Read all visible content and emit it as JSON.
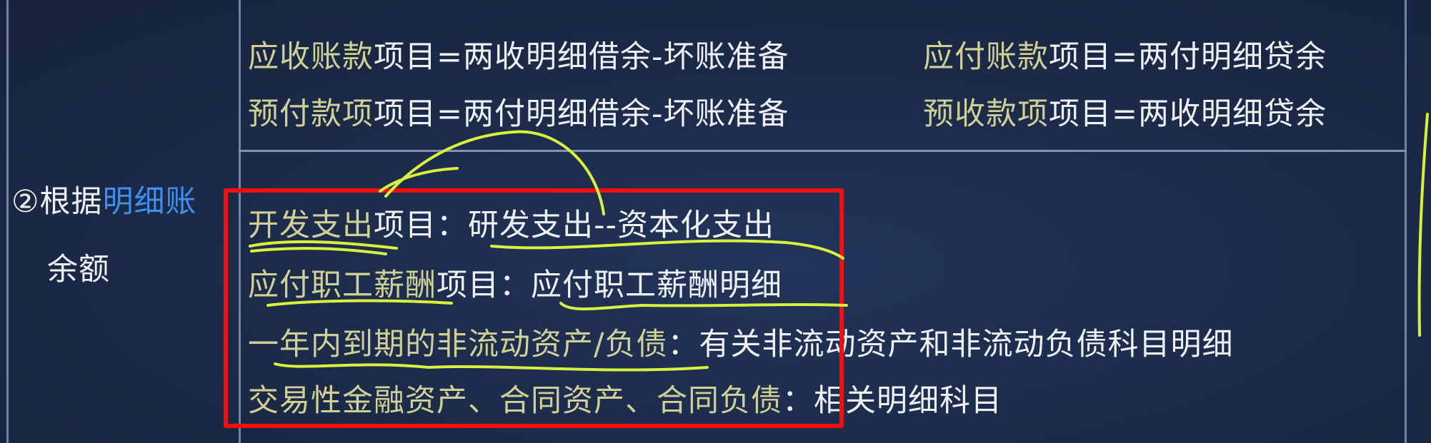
{
  "left_label": {
    "prefix": "②根据",
    "highlight": "明细账",
    "line2": "余额"
  },
  "top_rows": [
    {
      "left": {
        "hl": "应收账款",
        "rest": "项目=两收明细借余-坏账准备"
      },
      "right": {
        "hl": "应付账款",
        "rest": "项目=两付明细贷余"
      }
    },
    {
      "left": {
        "hl": "预付款项",
        "rest": "项目=两付明细借余-坏账准备"
      },
      "right": {
        "hl": "预收款项",
        "rest": "项目=两收明细贷余"
      }
    }
  ],
  "bottom_rows": [
    {
      "hl": "开发支出",
      "rest": "项目：研发支出--资本化支出"
    },
    {
      "hl": "应付职工薪酬",
      "rest": "项目：应付职工薪酬明细"
    },
    {
      "hl": "一年内到期的非流动资产/负债",
      "rest": "：有关非流动资产和非流动负债科目明细"
    },
    {
      "hl": "交易性金融资产、合同资产、合同负债",
      "rest": "：相关明细科目"
    }
  ],
  "colors": {
    "background": "#1b2946",
    "highlight_text": "#cfcf96",
    "keyword_blue": "#3d8ff0",
    "annotation_ink": "#d9f03c",
    "annotation_box": "#f01010"
  }
}
